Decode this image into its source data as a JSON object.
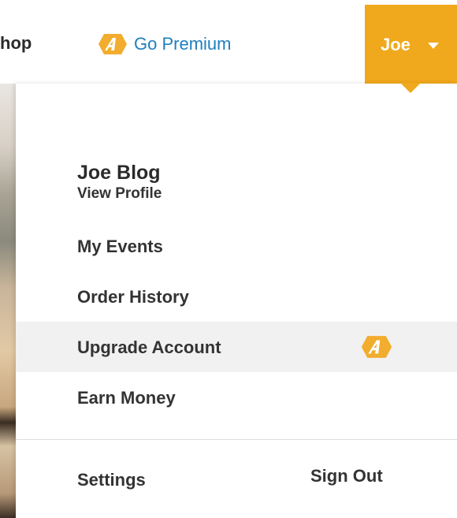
{
  "nav": {
    "shop_label": "hop",
    "premium_label": "Go Premium",
    "user_label": "Joe"
  },
  "profile": {
    "name": "Joe Blog",
    "link": "View Profile"
  },
  "menu": {
    "items": [
      {
        "label": "My Events"
      },
      {
        "label": "Order History"
      },
      {
        "label": "Upgrade Account"
      },
      {
        "label": "Earn Money"
      }
    ]
  },
  "footer": {
    "settings_label": "Settings",
    "signout_label": "Sign Out"
  },
  "icons": {
    "premium": "premium-badge-icon",
    "user_caret": "caret-down-icon"
  },
  "colors": {
    "accent": "#f0a81c",
    "link": "#1f7fbe",
    "highlight_row": "#f1f1f1"
  }
}
